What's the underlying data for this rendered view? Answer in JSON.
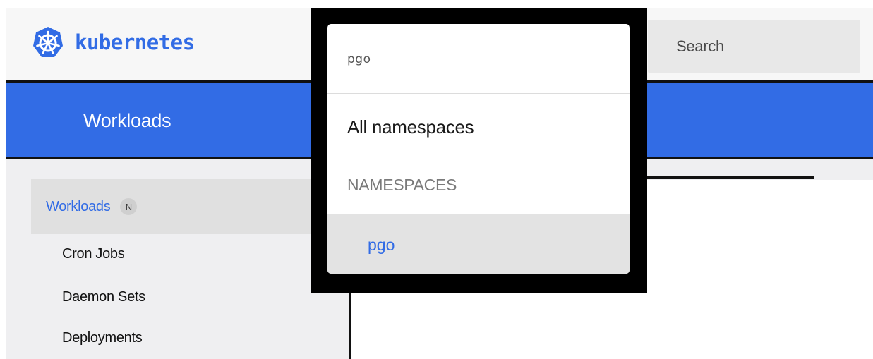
{
  "header": {
    "brand": "kubernetes",
    "search_label": "Search"
  },
  "nav": {
    "title": "Workloads"
  },
  "sidebar": {
    "section": {
      "label": "Workloads",
      "badge": "N"
    },
    "items": [
      {
        "label": "Cron Jobs"
      },
      {
        "label": "Daemon Sets"
      },
      {
        "label": "Deployments"
      }
    ]
  },
  "namespace_dropdown": {
    "search_value": "pgo",
    "all_option": "All namespaces",
    "section_heading": "NAMESPACES",
    "options": [
      {
        "label": "pgo",
        "selected": true
      }
    ]
  },
  "colors": {
    "accent": "#326ce5",
    "nav_text": "#ffffff",
    "sidebar_bg": "#efeff1",
    "overlay_frame": "#000000"
  },
  "icons": {
    "logo": "kubernetes-helm-icon"
  }
}
